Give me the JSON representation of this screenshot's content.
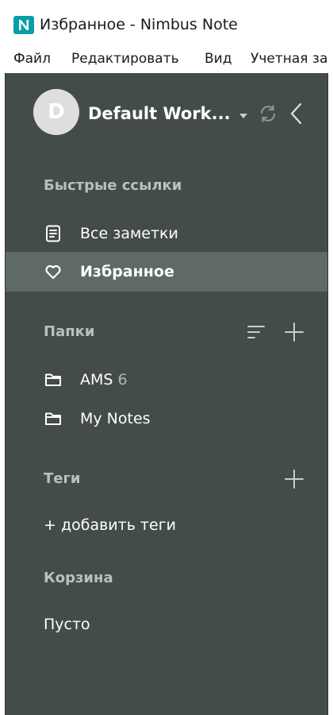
{
  "window": {
    "title": "Избранное - Nimbus Note",
    "logo_letter": "N",
    "logo_color": "#0a9da8"
  },
  "menu": {
    "items": [
      "Файл",
      "Редактировать",
      "Вид",
      "Учетная за"
    ]
  },
  "workspace": {
    "avatar_letter": "D",
    "name": "Default Work..."
  },
  "quick_links": {
    "heading": "Быстрые ссылки",
    "items": [
      {
        "label": "Все заметки",
        "icon": "note-icon",
        "active": false
      },
      {
        "label": "Избранное",
        "icon": "heart-icon",
        "active": true
      }
    ]
  },
  "folders": {
    "heading": "Папки",
    "items": [
      {
        "label": "AMS",
        "count": "6",
        "icon": "folder-icon"
      },
      {
        "label": "My Notes",
        "count": "",
        "icon": "folder-icon"
      }
    ]
  },
  "tags": {
    "heading": "Теги",
    "add_label": "+ добавить теги"
  },
  "trash": {
    "heading": "Корзина",
    "status": "Пусто"
  },
  "colors": {
    "sidebar_bg": "#434c4a",
    "active_item_bg": "#5f6967",
    "heading_text": "#b9c1bf"
  }
}
